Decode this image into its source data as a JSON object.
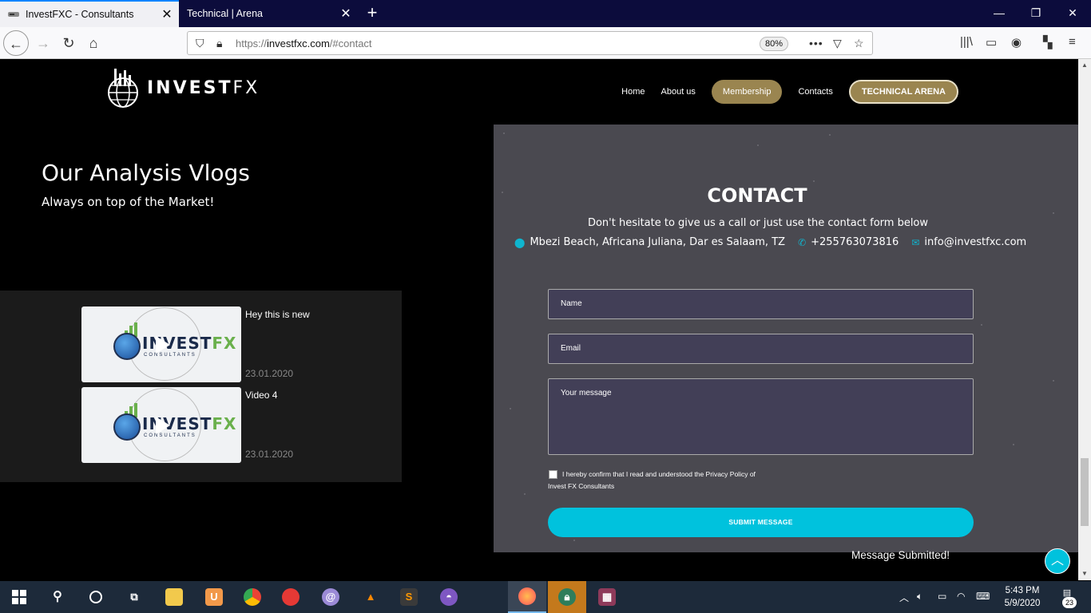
{
  "browser": {
    "tabs": [
      {
        "title": "InvestFXC - Consultants",
        "active": true
      },
      {
        "title": "Technical | Arena",
        "active": false
      }
    ],
    "new_tab_label": "+",
    "url_prefix": "https://",
    "url_host": "investfxc.com",
    "url_path": "/#contact",
    "zoom": "80%",
    "window_controls": [
      "minimize-icon",
      "restore-icon",
      "close-icon"
    ]
  },
  "site": {
    "logo_text_bold": "INVEST",
    "logo_text_thin": "FX",
    "nav": [
      {
        "label": "Home",
        "style": "plain"
      },
      {
        "label": "About us",
        "style": "plain"
      },
      {
        "label": "Membership",
        "style": "pill"
      },
      {
        "label": "Contacts",
        "style": "plain"
      },
      {
        "label": "TECHNICAL ARENA",
        "style": "outline"
      }
    ],
    "accent_gold": "#9a8550",
    "accent_cyan": "#00c2dd"
  },
  "vlogs": {
    "title": "Our Analysis Vlogs",
    "subtitle": "Always on top of the Market!",
    "items": [
      {
        "title": "Hey this is new",
        "date": "23.01.2020",
        "thumb_text": "INVEST",
        "thumb_fx": "FX",
        "thumb_sub": "CONSULTANTS"
      },
      {
        "title": "Video 4",
        "date": "23.01.2020",
        "thumb_text": "INVEST",
        "thumb_fx": "FX",
        "thumb_sub": "CONSULTANTS"
      }
    ]
  },
  "contact": {
    "title": "CONTACT",
    "lead": "Don't hesitate to give us a call or just use the contact form below",
    "address": "Mbezi Beach, Africana Juliana, Dar es Salaam, TZ",
    "phone": "+255763073816",
    "email": "info@investfxc.com",
    "form": {
      "name_placeholder": "Name",
      "email_placeholder": "Email",
      "message_placeholder": "Your message",
      "consent_line1": "I hereby confirm that I read and understood the Privacy Policy of",
      "consent_line2": "Invest FX Consultants",
      "submit_label": "SUBMIT MESSAGE"
    },
    "status_message": "Message Submitted!"
  },
  "taskbar": {
    "time": "5:43 PM",
    "date": "5/9/2020",
    "notification_count": "23"
  }
}
